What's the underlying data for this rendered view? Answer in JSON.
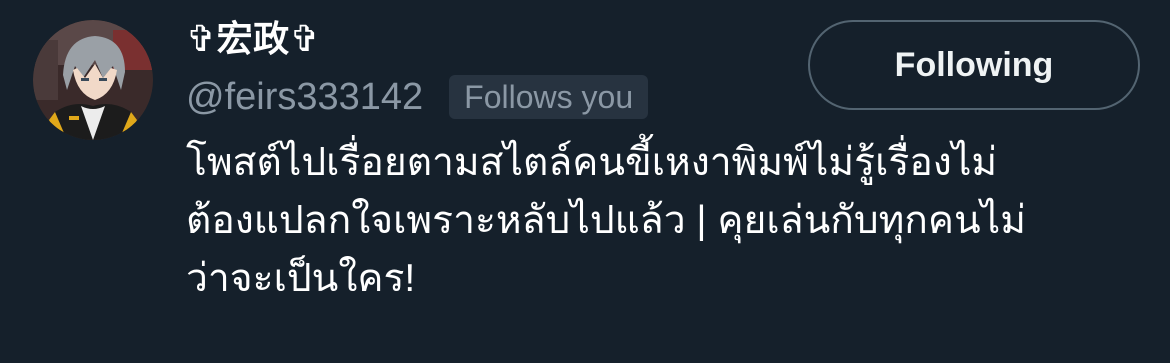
{
  "user": {
    "display_name": "✞宏政✞",
    "handle": "@feirs333142",
    "follows_you_label": "Follows you",
    "avatar_icon": "anime-character-avatar"
  },
  "follow_button": {
    "label": "Following"
  },
  "bio": {
    "lines": [
      "โพสต์ไปเรื่อยตามสไตล์คนขี้เหงาพิมพ์ไม่รู้เรื่องไม่",
      "ต้องแปลกใจเพราะหลับไปแล้ว | คุยเล่นกับทุกคนไม่",
      "ว่าจะเป็นใคร!"
    ]
  },
  "colors": {
    "background": "#15202b",
    "secondary_text": "#8b98a5",
    "badge_background": "#273340",
    "button_border": "#536471"
  }
}
